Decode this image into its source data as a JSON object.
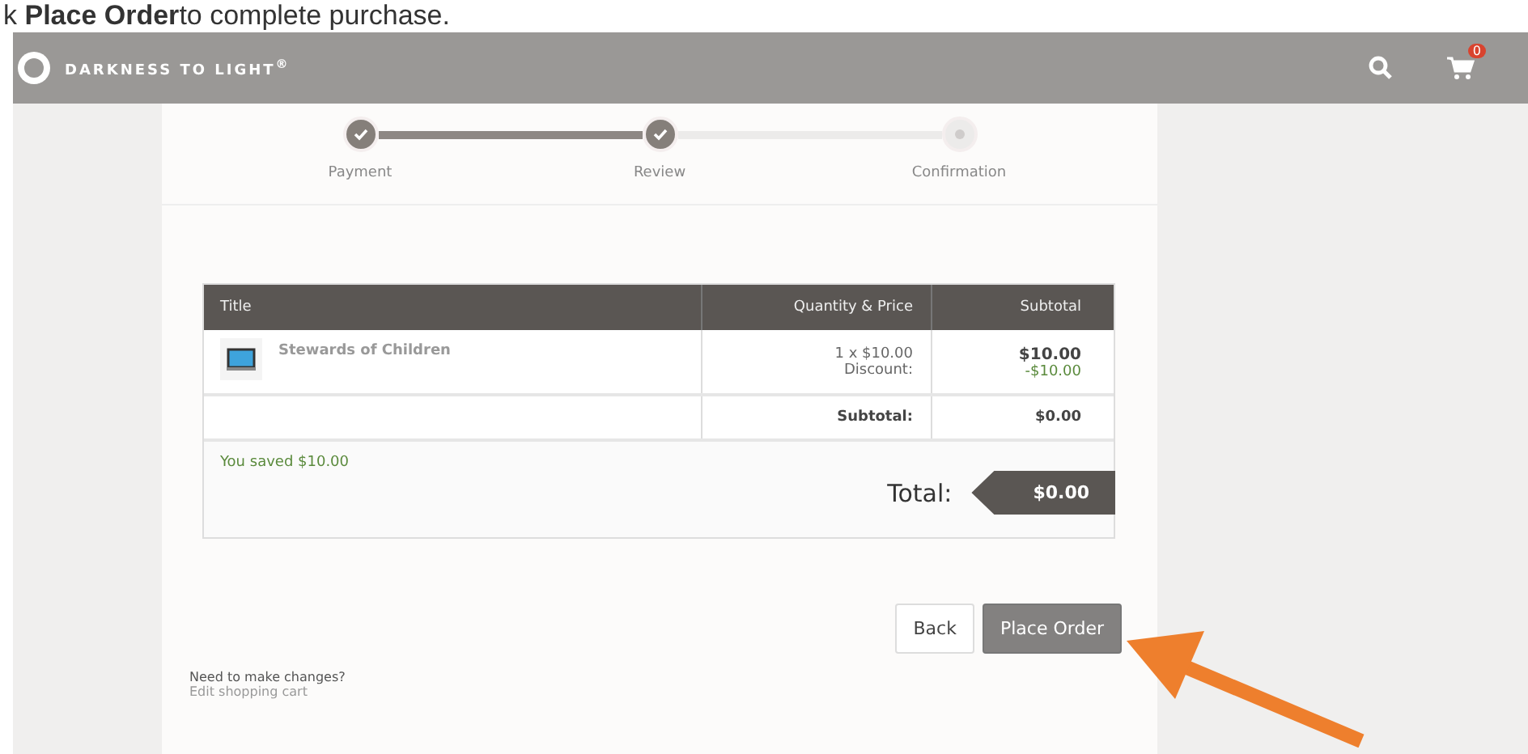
{
  "caption": "k **Place Order**to complete purchase.",
  "header": {
    "brand": "DARKNESS TO LIGHT$^{®}$",
    "cart_count": "0"
  },
  "steps": [
    {
      "label": "Payment",
      "done": true
    },
    {
      "label": "Review",
      "done": true
    },
    {
      "label": "Confirmation",
      "done": false
    }
  ],
  "table": {
    "columns": [
      "Title",
      "Quantity & Price",
      "Subtotal"
    ],
    "rows": [
      {
        "title": "Stewards of Children",
        "quantity": "1 x $10.00",
        "discount_label": "Discount:",
        "price": "$10.00",
        "discount": "-$10.00"
      }
    ],
    "subtotal_label": "Subtotal:",
    "subtotal": "$0.00"
  },
  "savings": "You saved $10.00",
  "total_label": "Total:",
  "total": "$0.00",
  "buttons": [
    {
      "label": "Back",
      "kind": "secondary"
    },
    {
      "label": "Place Order",
      "kind": "primary"
    }
  ],
  "changes_note": "Need to make changes?",
  "edit_link": "Edit shopping cart"
}
